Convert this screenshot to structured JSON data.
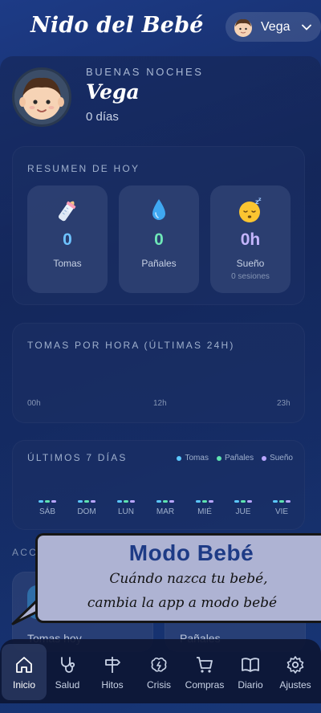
{
  "header": {
    "brand": "Nido del Bebé",
    "profile_name": "Vega"
  },
  "hero": {
    "greeting": "BUENAS NOCHES",
    "name": "Vega",
    "age": "0 días"
  },
  "summary": {
    "title": "RESUMEN DE HOY",
    "stats": [
      {
        "icon": "baby-bottle-icon",
        "value": "0",
        "label": "Tomas",
        "sub": "",
        "color": "#6ec3ff"
      },
      {
        "icon": "droplet-icon",
        "value": "0",
        "label": "Pañales",
        "sub": "",
        "color": "#6ee7b7"
      },
      {
        "icon": "sleeping-face-icon",
        "value": "0h",
        "label": "Sueño",
        "sub": "0 sesiones",
        "color": "#c4b5fd"
      }
    ]
  },
  "hourly": {
    "title": "TOMAS POR HORA (ÚLTIMAS 24H)",
    "ticks": [
      "00h",
      "12h",
      "23h"
    ]
  },
  "week": {
    "title": "ÚLTIMOS 7 DÍAS",
    "legend": [
      {
        "label": "Tomas",
        "color": "#5cc8ff"
      },
      {
        "label": "Pañales",
        "color": "#5ee3b0"
      },
      {
        "label": "Sueño",
        "color": "#b9a6ff"
      }
    ],
    "days": [
      "SÁB",
      "DOM",
      "LUN",
      "MAR",
      "MIÉ",
      "JUE",
      "VIE"
    ]
  },
  "quick_actions": {
    "title": "ACCIONES RÁPIDAS",
    "items": [
      {
        "label": "Tomas hoy"
      },
      {
        "label": "Pañales"
      }
    ]
  },
  "banner": {
    "title": "Modo Bebé",
    "line1": "Cuándo nazca tu bebé,",
    "line2": "cambia la app a modo bebé"
  },
  "nav": {
    "items": [
      {
        "label": "Inicio",
        "icon": "home-icon",
        "active": true
      },
      {
        "label": "Salud",
        "icon": "stethoscope-icon",
        "active": false
      },
      {
        "label": "Hitos",
        "icon": "signpost-icon",
        "active": false
      },
      {
        "label": "Crisis",
        "icon": "brain-icon",
        "active": false
      },
      {
        "label": "Compras",
        "icon": "cart-icon",
        "active": false
      },
      {
        "label": "Diario",
        "icon": "book-icon",
        "active": false
      },
      {
        "label": "Ajustes",
        "icon": "gear-icon",
        "active": false
      }
    ]
  }
}
